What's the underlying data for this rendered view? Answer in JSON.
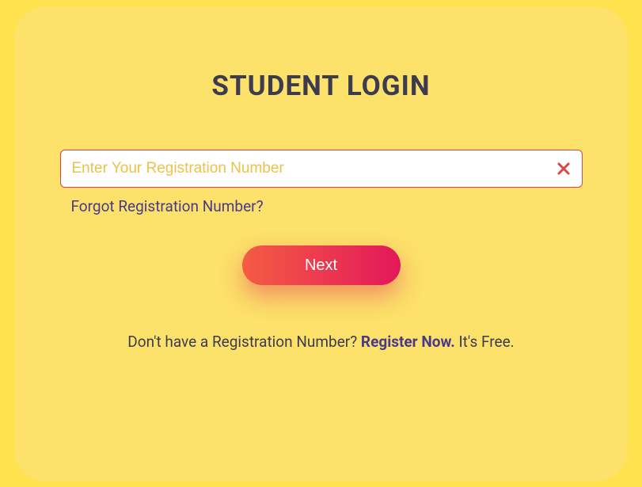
{
  "title": "STUDENT LOGIN",
  "input": {
    "placeholder": "Enter Your Registration Number",
    "value": ""
  },
  "forgot_link": "Forgot Registration Number?",
  "next_button": "Next",
  "footer": {
    "prefix": "Don't have a Registration Number? ",
    "register": "Register Now.",
    "suffix": " It's Free."
  }
}
